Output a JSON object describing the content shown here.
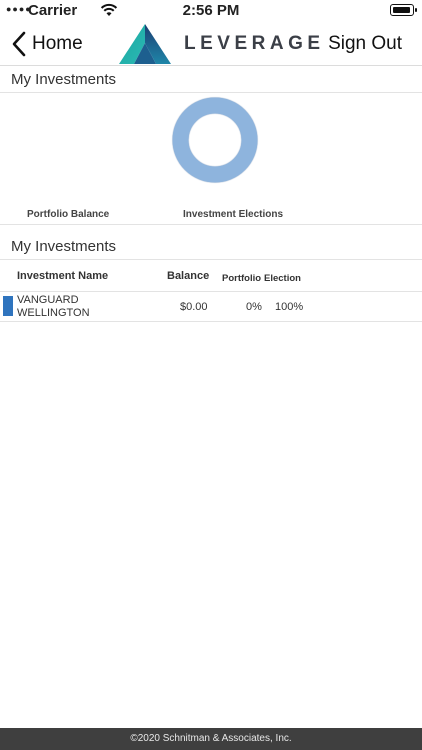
{
  "status_bar": {
    "carrier": "Carrier",
    "time": "2:56 PM"
  },
  "nav": {
    "back_label": "Home",
    "logo_text": "LEVERAGE",
    "sign_out_label": "Sign Out"
  },
  "sections": {
    "chart_title": "My Investments",
    "table_title": "My Investments"
  },
  "chart": {
    "portfolio_label": "Portfolio Balance",
    "elections_label": "Investment Elections",
    "election_ring_color": "#8eb4dd",
    "election_ring_stroke": "#7a95b8"
  },
  "table": {
    "headers": {
      "name": "Investment Name",
      "balance": "Balance",
      "portfolio": "Portfolio",
      "election": "Election"
    },
    "rows": [
      {
        "swatch_color": "#2f74be",
        "name": "VANGUARD WELLINGTON",
        "balance": "$0.00",
        "portfolio": "0%",
        "election": "100%"
      }
    ]
  },
  "footer": {
    "copyright": "©2020 Schnitman & Associates, Inc."
  },
  "icons": {
    "back": "chevron-left-icon",
    "wifi": "wifi-icon",
    "battery": "battery-icon",
    "logo": "leverage-logo-icon"
  }
}
